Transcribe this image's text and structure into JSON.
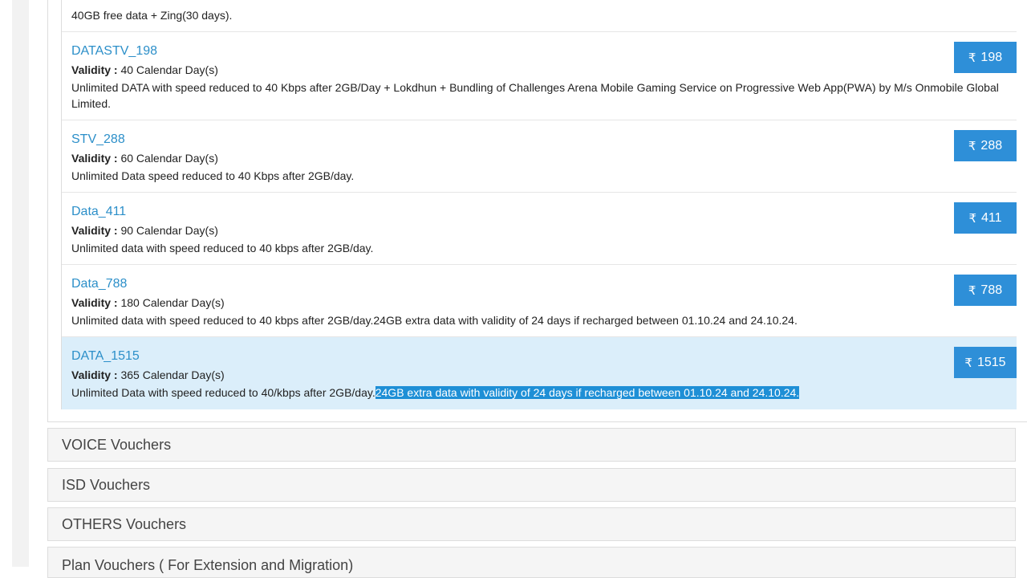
{
  "plans": [
    {
      "description": "40GB free data + Zing(30 days)."
    },
    {
      "name": "DATASTV_198",
      "validity_label": "Validity :",
      "validity_value": " 40 Calendar Day(s)",
      "description": "Unlimited DATA with speed reduced to 40 Kbps after 2GB/Day + Lokdhun + Bundling of Challenges Arena Mobile Gaming Service on Progressive Web App(PWA) by M/s Onmobile Global Limited.",
      "currency_icon": "rupee-icon",
      "price_symbol": "₹",
      "price": "198"
    },
    {
      "name": "STV_288",
      "validity_label": "Validity :",
      "validity_value": " 60 Calendar Day(s)",
      "description": "Unlimited Data speed reduced to 40 Kbps after 2GB/day.",
      "price_symbol": "₹",
      "price": "288"
    },
    {
      "name": "Data_411",
      "validity_label": "Validity :",
      "validity_value": " 90 Calendar Day(s)",
      "description": "Unlimited data with speed reduced to 40 kbps after 2GB/day.",
      "price_symbol": "₹",
      "price": "411"
    },
    {
      "name": "Data_788",
      "validity_label": "Validity :",
      "validity_value": " 180 Calendar Day(s)",
      "description": "Unlimited data with speed reduced to 40 kbps after 2GB/day.24GB extra data with validity of 24 days if recharged between 01.10.24 and 24.10.24.",
      "price_symbol": "₹",
      "price": "788"
    },
    {
      "name": "DATA_1515",
      "validity_label": "Validity :",
      "validity_value": " 365 Calendar Day(s)",
      "description_plain": "Unlimited Data with speed reduced to 40/kbps after 2GB/day.",
      "description_selected": "24GB extra data with validity of 24 days if recharged between 01.10.24 and 24.10.24.",
      "price_symbol": "₹",
      "price": "1515",
      "selected": true
    }
  ],
  "accordions": [
    "VOICE Vouchers",
    "ISD Vouchers",
    "OTHERS Vouchers",
    "Plan Vouchers ( For Extension and Migration)"
  ],
  "colors": {
    "link": "#2c8fc9",
    "button": "#2e8fd8",
    "selected_row": "#dbeefa",
    "text_highlight": "#1e8fd6"
  }
}
